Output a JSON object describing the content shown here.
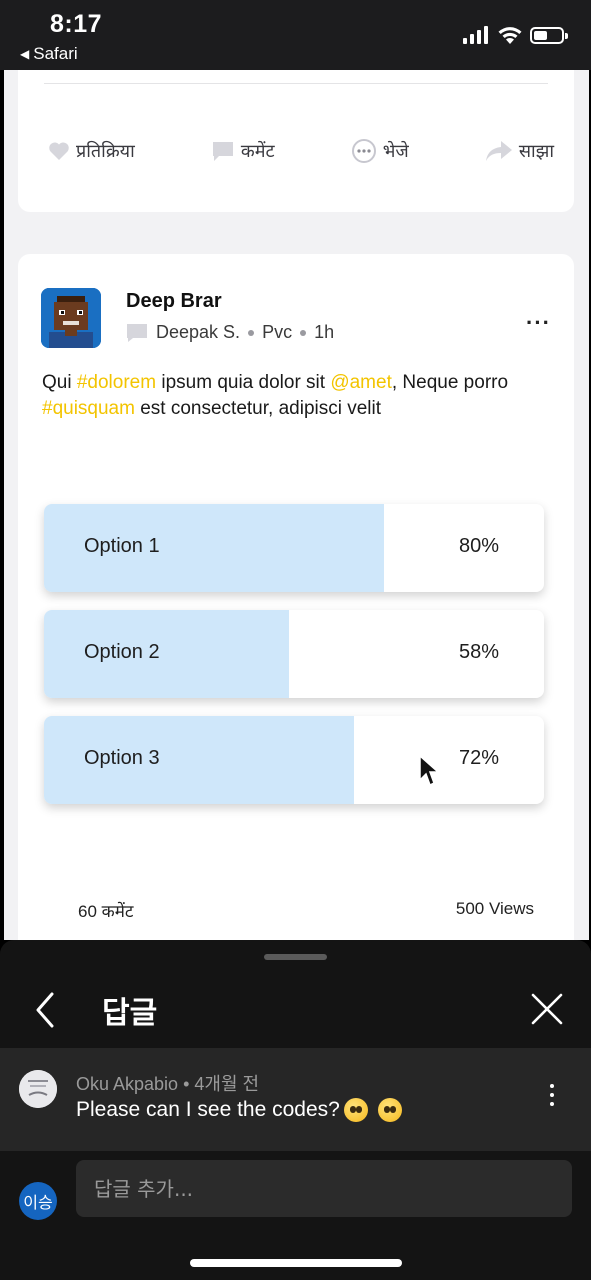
{
  "status_bar": {
    "time": "8:17",
    "back_app": "Safari"
  },
  "card_actions": [
    {
      "label": "प्रतिक्रिया",
      "icon": "heart-icon"
    },
    {
      "label": "कमेंट",
      "icon": "comment-icon"
    },
    {
      "label": "भेजे",
      "icon": "message-icon"
    },
    {
      "label": "साझा",
      "icon": "share-icon"
    }
  ],
  "post": {
    "author": "Deep Brar",
    "group": "Deepak S.",
    "visibility": "Pvc",
    "time": "1h",
    "text_parts": [
      {
        "text": "Qui ",
        "tag": false
      },
      {
        "text": "#dolorem",
        "tag": true
      },
      {
        "text": " ipsum quia dolor sit ",
        "tag": false
      },
      {
        "text": "@amet",
        "tag": true
      },
      {
        "text": ", Neque porro ",
        "tag": false
      },
      {
        "text": "#quisquam",
        "tag": true
      },
      {
        "text": " est  consectetur, adipisci velit",
        "tag": false
      }
    ],
    "tag_color": "#f3c400",
    "options": [
      {
        "label": "Option 1",
        "percent_label": "80%",
        "fill_fraction": 0.68
      },
      {
        "label": "Option 2",
        "percent_label": "58%",
        "fill_fraction": 0.49
      },
      {
        "label": "Option 3",
        "percent_label": "72%",
        "fill_fraction": 0.62
      }
    ],
    "fill_color": "#cfe7fa",
    "comments_count": "60 कमेंट",
    "views": "500 Views"
  },
  "replies_panel": {
    "title": "답글",
    "comment": {
      "author": "Oku Akpabio",
      "time": "4개월 전",
      "text": "Please can I see the codes?"
    },
    "me_avatar": "이승",
    "reply_placeholder": "답글 추가..."
  }
}
